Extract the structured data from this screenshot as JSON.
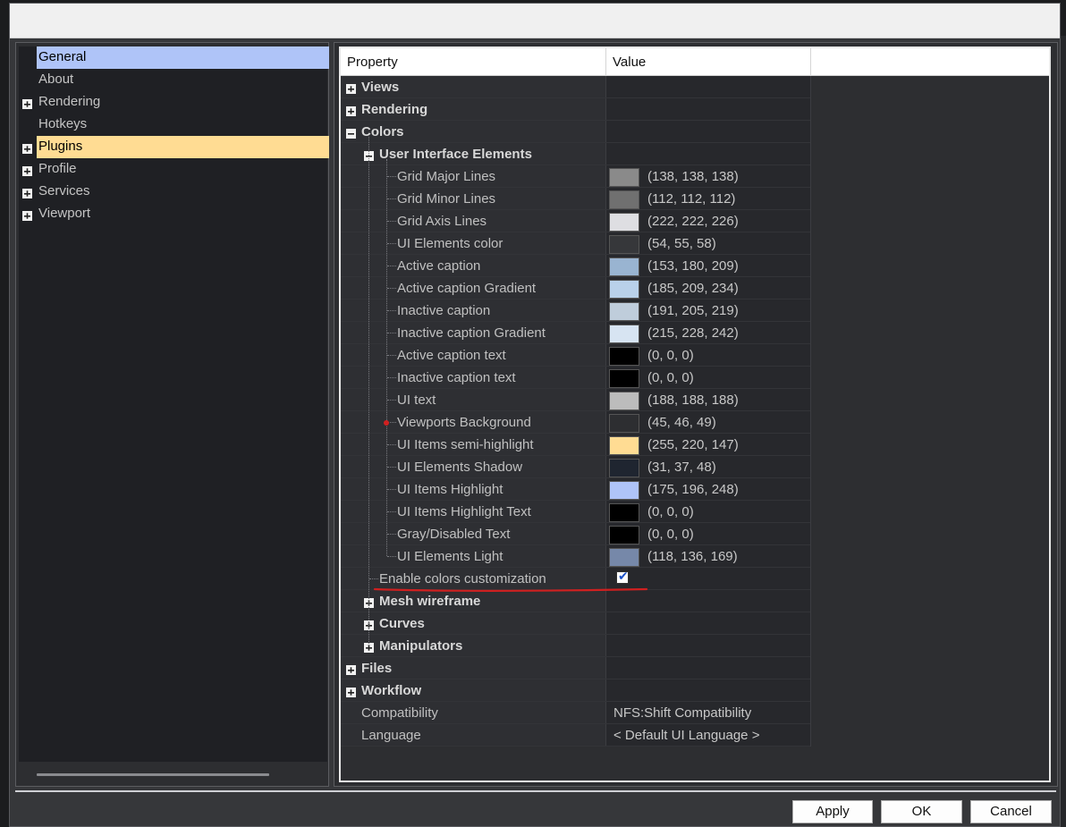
{
  "left_tree": {
    "items": [
      {
        "label": "General",
        "expandable": false,
        "state": "selected"
      },
      {
        "label": "About",
        "expandable": false,
        "state": ""
      },
      {
        "label": "Rendering",
        "expandable": true,
        "state": ""
      },
      {
        "label": "Hotkeys",
        "expandable": false,
        "state": ""
      },
      {
        "label": "Plugins",
        "expandable": true,
        "state": "highlight"
      },
      {
        "label": "Profile",
        "expandable": true,
        "state": ""
      },
      {
        "label": "Services",
        "expandable": true,
        "state": ""
      },
      {
        "label": "Viewport",
        "expandable": true,
        "state": ""
      }
    ]
  },
  "grid": {
    "header": {
      "property": "Property",
      "value": "Value"
    },
    "groups": {
      "views": "Views",
      "rendering": "Rendering",
      "colors": "Colors",
      "ui_elements": "User Interface Elements",
      "mesh_wireframe": "Mesh wireframe",
      "curves": "Curves",
      "manipulators": "Manipulators",
      "files": "Files",
      "workflow": "Workflow"
    },
    "colors": [
      {
        "name": "Grid Major Lines",
        "value": "(138, 138, 138)",
        "hex": "#8a8a8a"
      },
      {
        "name": "Grid Minor Lines",
        "value": "(112, 112, 112)",
        "hex": "#707070"
      },
      {
        "name": "Grid Axis Lines",
        "value": "(222, 222, 226)",
        "hex": "#dedee2"
      },
      {
        "name": "UI Elements color",
        "value": "(54, 55, 58)",
        "hex": "#36373a"
      },
      {
        "name": "Active caption",
        "value": "(153, 180, 209)",
        "hex": "#99b4d1"
      },
      {
        "name": "Active caption Gradient",
        "value": "(185, 209, 234)",
        "hex": "#b9d1ea"
      },
      {
        "name": "Inactive caption",
        "value": "(191, 205, 219)",
        "hex": "#bfcddb"
      },
      {
        "name": "Inactive caption Gradient",
        "value": "(215, 228, 242)",
        "hex": "#d7e4f2"
      },
      {
        "name": "Active caption text",
        "value": "(0, 0, 0)",
        "hex": "#000000"
      },
      {
        "name": "Inactive caption text",
        "value": "(0, 0, 0)",
        "hex": "#000000"
      },
      {
        "name": "UI text",
        "value": "(188, 188, 188)",
        "hex": "#bcbcbc"
      },
      {
        "name": "Viewports Background",
        "value": "(45, 46, 49)",
        "hex": "#2d2e31"
      },
      {
        "name": "UI Items semi-highlight",
        "value": "(255, 220, 147)",
        "hex": "#ffdc93"
      },
      {
        "name": "UI Elements Shadow",
        "value": "(31, 37, 48)",
        "hex": "#1f2530"
      },
      {
        "name": "UI Items Highlight",
        "value": "(175, 196, 248)",
        "hex": "#afc4f8"
      },
      {
        "name": "UI Items Highlight Text",
        "value": "(0, 0, 0)",
        "hex": "#000000"
      },
      {
        "name": "Gray/Disabled Text",
        "value": "(0, 0, 0)",
        "hex": "#000000"
      },
      {
        "name": "UI Elements Light",
        "value": "(118, 136, 169)",
        "hex": "#7688a9"
      }
    ],
    "enable_colors": {
      "label": "Enable colors customization",
      "checked": true
    },
    "compatibility": {
      "label": "Compatibility",
      "value": "NFS:Shift Compatibility"
    },
    "language": {
      "label": "Language",
      "value": "< Default UI Language >"
    }
  },
  "buttons": {
    "apply": "Apply",
    "ok": "OK",
    "cancel": "Cancel"
  },
  "accent": {
    "selected": "#afc4f8",
    "highlight": "#ffdc93",
    "annotation": "#d02020"
  }
}
